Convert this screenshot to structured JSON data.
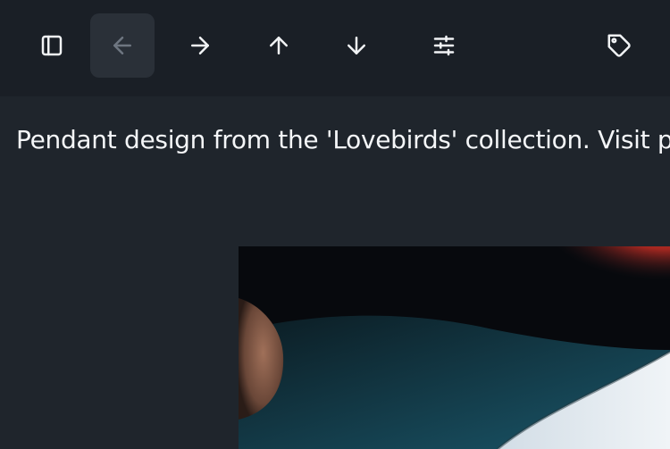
{
  "toolbar": {
    "buttons": [
      {
        "name": "sidebar-toggle-button",
        "icon": "sidebar-icon",
        "enabled": true
      },
      {
        "name": "back-button",
        "icon": "arrow-left-icon",
        "enabled": false
      },
      {
        "name": "forward-button",
        "icon": "arrow-right-icon",
        "enabled": true
      },
      {
        "name": "previous-button",
        "icon": "arrow-up-icon",
        "enabled": true
      },
      {
        "name": "next-button",
        "icon": "arrow-down-icon",
        "enabled": true
      },
      {
        "name": "adjustments-button",
        "icon": "sliders-icon",
        "enabled": true
      },
      {
        "name": "tag-button",
        "icon": "tag-icon",
        "enabled": true
      }
    ]
  },
  "main": {
    "caption": "Pendant design from the 'Lovebirds' collection. Visit pr",
    "image": {
      "description_icon": "photo-icon"
    }
  },
  "colors": {
    "toolbar_bg": "#1a1f26",
    "main_bg": "#1f252c",
    "text": "#f4f6f8",
    "disabled_button_bg": "#2a3038",
    "icon_enabled": "#f1f3f5",
    "icon_disabled": "#6e7681"
  }
}
